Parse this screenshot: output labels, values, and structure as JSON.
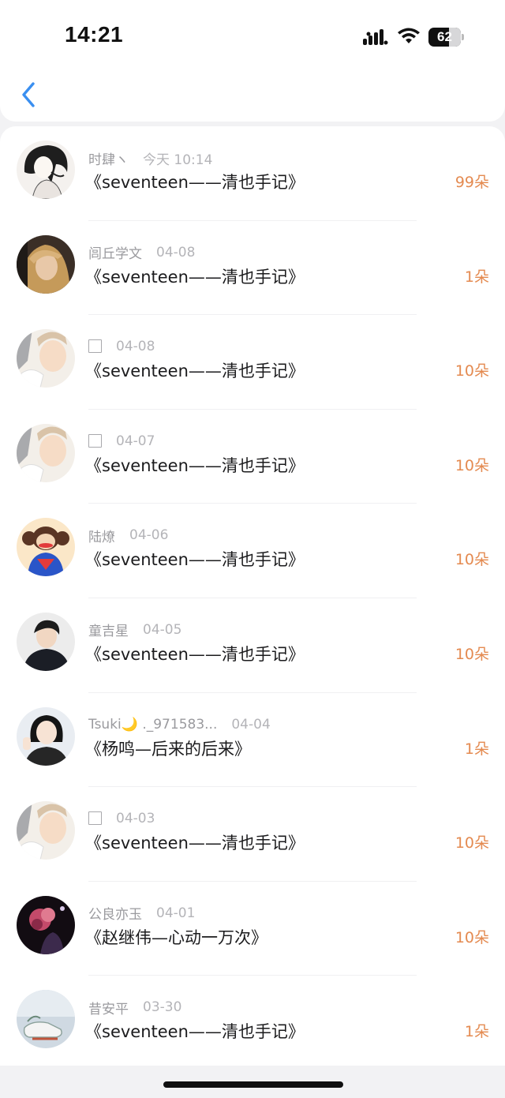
{
  "status_bar": {
    "time": "14:21",
    "battery_level": "62",
    "icons": [
      "signal-icon",
      "wifi-icon",
      "battery-icon"
    ]
  },
  "nav": {
    "back_icon": "chevron-left-icon",
    "accent_color": "#3a8ff0"
  },
  "colors": {
    "amount": "#e48a50",
    "name": "#9a9a9e",
    "title": "#1b1b1d"
  },
  "records": [
    {
      "name": "时肆ヽ",
      "date": "今天 10:14",
      "title": "《seventeen——清也手记》",
      "amount": "99朵",
      "avatar": "sketch-girl"
    },
    {
      "name": "闾丘学文",
      "date": "04-08",
      "title": "《seventeen——清也手记》",
      "amount": "1朵",
      "avatar": "blonde-portrait"
    },
    {
      "name": "",
      "name_is_box": true,
      "date": "04-08",
      "title": "《seventeen——清也手记》",
      "amount": "10朵",
      "avatar": "pale-selfie"
    },
    {
      "name": "",
      "name_is_box": true,
      "date": "04-07",
      "title": "《seventeen——清也手记》",
      "amount": "10朵",
      "avatar": "pale-selfie"
    },
    {
      "name": "陆燎",
      "date": "04-06",
      "title": "《seventeen——清也手记》",
      "amount": "10朵",
      "avatar": "monkey-cartoon"
    },
    {
      "name": "童吉星",
      "date": "04-05",
      "title": "《seventeen——清也手记》",
      "amount": "10朵",
      "avatar": "boy-dark"
    },
    {
      "name": "Tsuki🌙 ._971583...",
      "date": "04-04",
      "title": "《杨鸣—后来的后来》",
      "amount": "1朵",
      "avatar": "girl-peace"
    },
    {
      "name": "",
      "name_is_box": true,
      "date": "04-03",
      "title": "《seventeen——清也手记》",
      "amount": "10朵",
      "avatar": "pale-selfie"
    },
    {
      "name": "公良亦玉",
      "date": "04-01",
      "title": "《赵继伟—心动一万次》",
      "amount": "10朵",
      "avatar": "dark-flower"
    },
    {
      "name": "昔安平",
      "date": "03-30",
      "title": "《seventeen——清也手记》",
      "amount": "1朵",
      "avatar": "sneakers-photo"
    }
  ]
}
